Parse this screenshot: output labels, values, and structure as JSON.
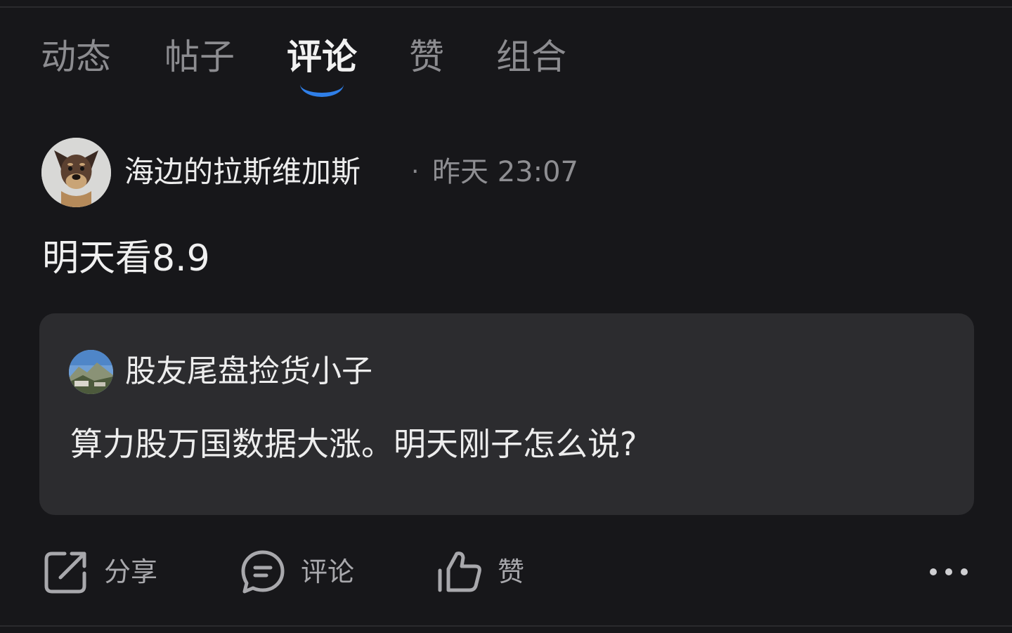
{
  "tabs": [
    {
      "label": "动态",
      "active": false
    },
    {
      "label": "帖子",
      "active": false
    },
    {
      "label": "评论",
      "active": true
    },
    {
      "label": "赞",
      "active": false
    },
    {
      "label": "组合",
      "active": false
    }
  ],
  "post": {
    "author": "海边的拉斯维加斯",
    "separator": "·",
    "time": "昨天 23:07",
    "text": "明天看8.9"
  },
  "quoted": {
    "author": "股友尾盘捡货小子",
    "text": "算力股万国数据大涨。明天刚子怎么说?"
  },
  "actions": {
    "share_label": "分享",
    "comment_label": "评论",
    "like_label": "赞"
  },
  "colors": {
    "background": "#17171a",
    "card": "#2c2c2f",
    "accent": "#2f7fe8"
  },
  "icons": [
    "share-icon",
    "comment-icon",
    "like-icon",
    "more-icon"
  ]
}
